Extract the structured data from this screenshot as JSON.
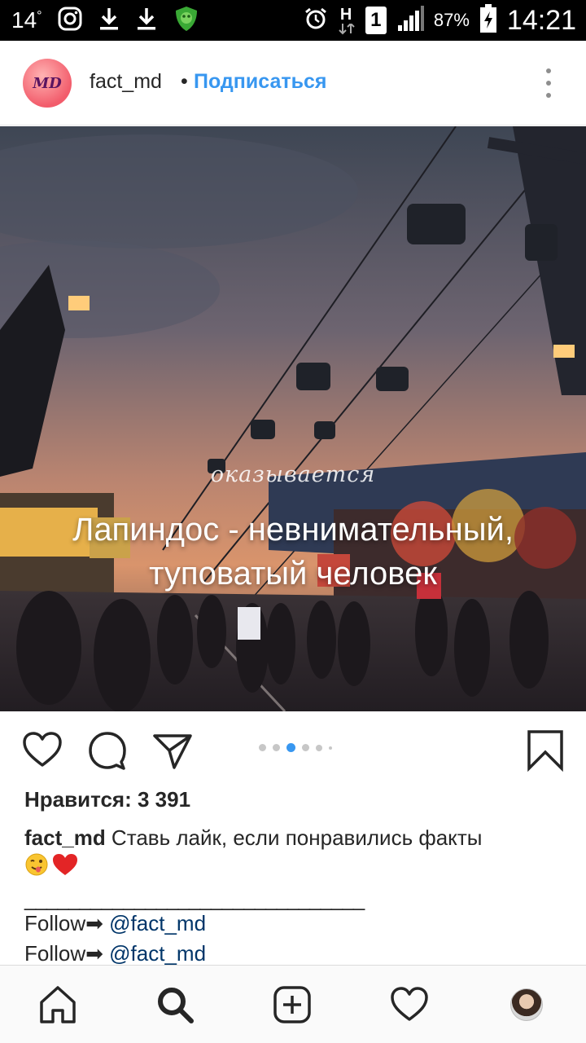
{
  "status_bar": {
    "temperature": "14",
    "battery_percent": "87%",
    "time": "14:21",
    "network_letter": "H",
    "sim_slot": "1",
    "icons": [
      "instagram-icon",
      "download-icon",
      "download-icon",
      "security-shield-icon",
      "alarm-icon",
      "network-h-icon",
      "sim-1-icon",
      "signal-icon",
      "battery-charging-icon"
    ]
  },
  "post": {
    "username": "fact_md",
    "separator": "•",
    "follow_label": "Подписаться",
    "avatar_text": "MD",
    "image_script_text": "оказывается",
    "image_caption_line1": "Лапиндос - невнимательный,",
    "image_caption_line2": "туповатый человек",
    "carousel_count": 6,
    "carousel_active": 2,
    "likes_text": "Нравится: 3 391",
    "caption_username": "fact_md",
    "caption_text": " Ставь лайк, если понравились факты",
    "caption_emojis": [
      "winking-tongue-emoji",
      "red-heart-emoji"
    ],
    "divider": "_______________________________",
    "follow_lines": [
      {
        "label": "Follow",
        "arrow": "➡",
        "mention": " @fact_md"
      },
      {
        "label": "Follow",
        "arrow": "➡",
        "mention": " @fact_md"
      }
    ]
  },
  "actions": [
    "like-icon",
    "comment-icon",
    "share-icon",
    "bookmark-icon"
  ],
  "bottom_nav": [
    "home-icon",
    "search-icon",
    "add-post-icon",
    "activity-heart-icon",
    "profile-avatar"
  ],
  "colors": {
    "link_blue": "#3897f0",
    "mention_blue": "#003569",
    "text": "#262626",
    "status_bar": "#000000"
  }
}
